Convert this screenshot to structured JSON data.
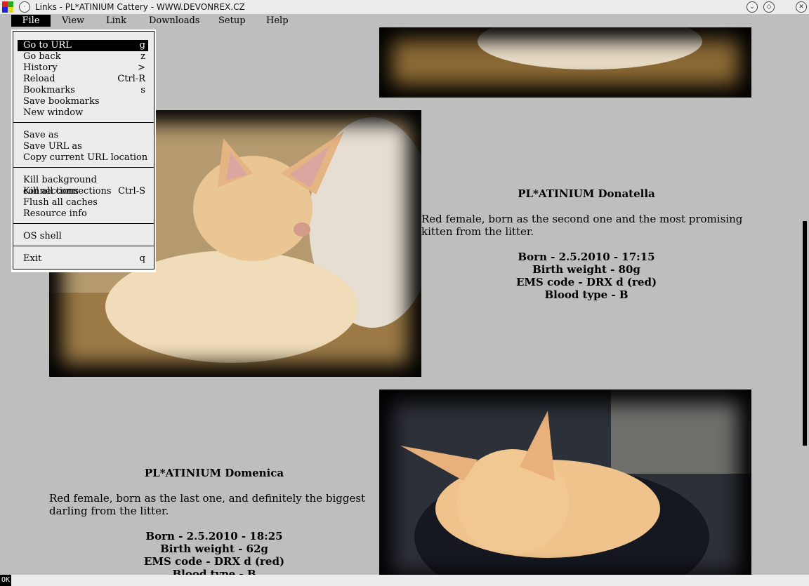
{
  "window": {
    "title": "Links - PL*ATINIUM Cattery - WWW.DEVONREX.CZ"
  },
  "menubar": {
    "items": [
      "File",
      "View",
      "Link",
      "Downloads",
      "Setup",
      "Help"
    ]
  },
  "file_menu": {
    "items": [
      {
        "label": "Go to URL",
        "key": "g"
      },
      {
        "label": "Go back",
        "key": "z"
      },
      {
        "label": "History",
        "key": ">"
      },
      {
        "label": "Reload",
        "key": "Ctrl-R"
      },
      {
        "label": "Bookmarks",
        "key": "s"
      },
      {
        "label": "Save bookmarks",
        "key": ""
      },
      {
        "label": "New window",
        "key": ""
      },
      {
        "label": "Save as",
        "key": ""
      },
      {
        "label": "Save URL as",
        "key": ""
      },
      {
        "label": "Copy current URL location",
        "key": ""
      },
      {
        "label": "Kill background connections",
        "key": ""
      },
      {
        "label": "Kill all connections",
        "key": "Ctrl-S"
      },
      {
        "label": "Flush all caches",
        "key": ""
      },
      {
        "label": "Resource info",
        "key": ""
      },
      {
        "label": "OS shell",
        "key": ""
      },
      {
        "label": "Exit",
        "key": "q"
      }
    ]
  },
  "kittens": [
    {
      "name": "PL*ATINIUM Donatella",
      "description": "Red female, born as the second one and the most promising kitten from the litter.",
      "born": "Born - 2.5.2010 - 17:15",
      "weight": "Birth weight - 80g",
      "ems": "EMS code - DRX d (red)",
      "blood": "Blood type - B"
    },
    {
      "name": "PL*ATINIUM Domenica",
      "description": "Red female, born as the last one, and definitely the biggest darling from the litter.",
      "born": "Born - 2.5.2010 - 18:25",
      "weight": "Birth weight - 62g",
      "ems": "EMS code - DRX d (red)",
      "blood": "Blood type - B"
    }
  ],
  "status": {
    "indicator": "OK"
  },
  "scroll": {
    "position_fraction": 0.6
  },
  "colors": {
    "page_bg": "#bebebe",
    "menu_highlight": "#000000",
    "photo_frame": "#000000"
  }
}
